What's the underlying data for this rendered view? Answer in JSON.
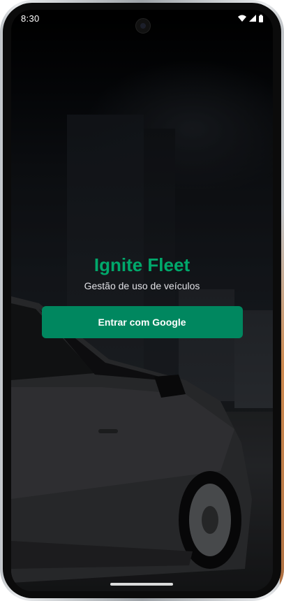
{
  "status_bar": {
    "time": "8:30",
    "icons": [
      "wifi-icon",
      "signal-icon",
      "battery-icon"
    ]
  },
  "app": {
    "title": "Ignite Fleet",
    "subtitle": "Gestão de uso de veículos"
  },
  "login": {
    "button_label": "Entrar com Google"
  },
  "colors": {
    "accent": "#00A86B",
    "button": "#00875F",
    "subtitle": "#E1E1E6",
    "background": "#000000"
  }
}
